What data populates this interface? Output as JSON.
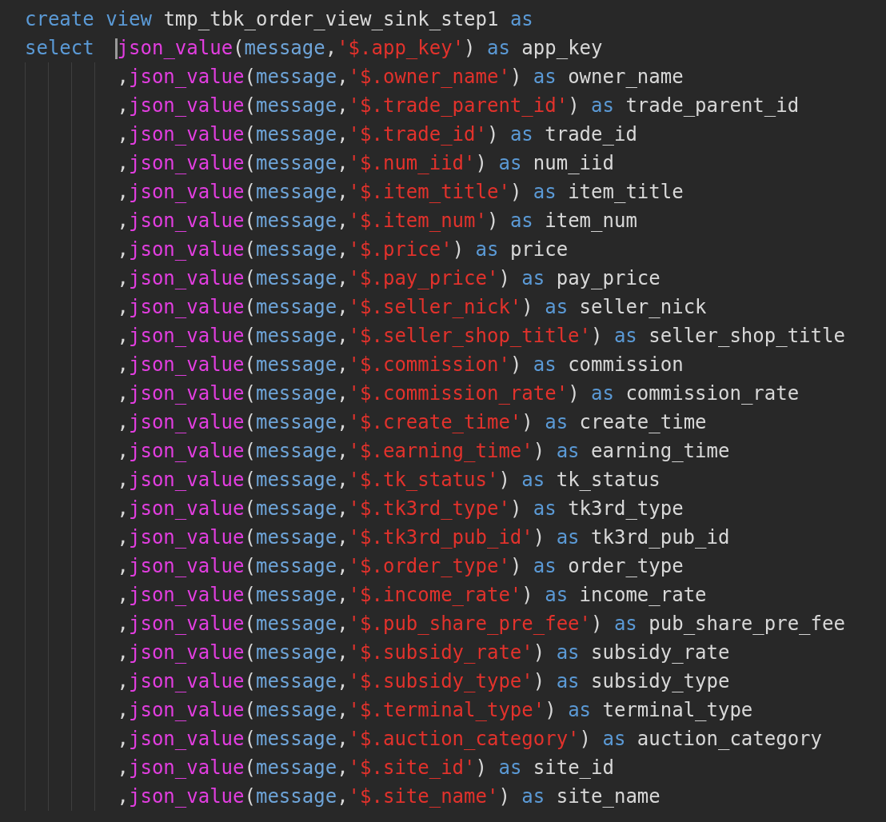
{
  "editor": {
    "lines": [
      {
        "indented": false,
        "tokens": [
          {
            "kind": "keyword",
            "text": "create "
          },
          {
            "kind": "keyword",
            "text": "view"
          },
          {
            "kind": "text",
            "text": " tmp_tbk_order_view_sink_step1 "
          },
          {
            "kind": "keyword",
            "text": "as"
          }
        ]
      },
      {
        "indented": false,
        "tokens": [
          {
            "kind": "keyword",
            "text": "select  "
          },
          {
            "kind": "function",
            "text": "json_value",
            "cursor": true
          },
          {
            "kind": "text",
            "text": "("
          },
          {
            "kind": "identifier",
            "text": "message"
          },
          {
            "kind": "text",
            "text": ","
          },
          {
            "kind": "string",
            "text": "'$.app_key'"
          },
          {
            "kind": "text",
            "text": ") "
          },
          {
            "kind": "keyword",
            "text": "as"
          },
          {
            "kind": "text",
            "text": " app_key"
          }
        ]
      },
      {
        "indented": true,
        "tokens": [
          {
            "kind": "text",
            "text": ","
          },
          {
            "kind": "function",
            "text": "json_value"
          },
          {
            "kind": "text",
            "text": "("
          },
          {
            "kind": "identifier",
            "text": "message"
          },
          {
            "kind": "text",
            "text": ","
          },
          {
            "kind": "string",
            "text": "'$.owner_name'"
          },
          {
            "kind": "text",
            "text": ") "
          },
          {
            "kind": "keyword",
            "text": "as"
          },
          {
            "kind": "text",
            "text": " owner_name"
          }
        ]
      },
      {
        "indented": true,
        "tokens": [
          {
            "kind": "text",
            "text": ","
          },
          {
            "kind": "function",
            "text": "json_value"
          },
          {
            "kind": "text",
            "text": "("
          },
          {
            "kind": "identifier",
            "text": "message"
          },
          {
            "kind": "text",
            "text": ","
          },
          {
            "kind": "string",
            "text": "'$.trade_parent_id'"
          },
          {
            "kind": "text",
            "text": ") "
          },
          {
            "kind": "keyword",
            "text": "as"
          },
          {
            "kind": "text",
            "text": " trade_parent_id"
          }
        ]
      },
      {
        "indented": true,
        "tokens": [
          {
            "kind": "text",
            "text": ","
          },
          {
            "kind": "function",
            "text": "json_value"
          },
          {
            "kind": "text",
            "text": "("
          },
          {
            "kind": "identifier",
            "text": "message"
          },
          {
            "kind": "text",
            "text": ","
          },
          {
            "kind": "string",
            "text": "'$.trade_id'"
          },
          {
            "kind": "text",
            "text": ") "
          },
          {
            "kind": "keyword",
            "text": "as"
          },
          {
            "kind": "text",
            "text": " trade_id"
          }
        ]
      },
      {
        "indented": true,
        "tokens": [
          {
            "kind": "text",
            "text": ","
          },
          {
            "kind": "function",
            "text": "json_value"
          },
          {
            "kind": "text",
            "text": "("
          },
          {
            "kind": "identifier",
            "text": "message"
          },
          {
            "kind": "text",
            "text": ","
          },
          {
            "kind": "string",
            "text": "'$.num_iid'"
          },
          {
            "kind": "text",
            "text": ") "
          },
          {
            "kind": "keyword",
            "text": "as"
          },
          {
            "kind": "text",
            "text": " num_iid"
          }
        ]
      },
      {
        "indented": true,
        "tokens": [
          {
            "kind": "text",
            "text": ","
          },
          {
            "kind": "function",
            "text": "json_value"
          },
          {
            "kind": "text",
            "text": "("
          },
          {
            "kind": "identifier",
            "text": "message"
          },
          {
            "kind": "text",
            "text": ","
          },
          {
            "kind": "string",
            "text": "'$.item_title'"
          },
          {
            "kind": "text",
            "text": ") "
          },
          {
            "kind": "keyword",
            "text": "as"
          },
          {
            "kind": "text",
            "text": " item_title"
          }
        ]
      },
      {
        "indented": true,
        "tokens": [
          {
            "kind": "text",
            "text": ","
          },
          {
            "kind": "function",
            "text": "json_value"
          },
          {
            "kind": "text",
            "text": "("
          },
          {
            "kind": "identifier",
            "text": "message"
          },
          {
            "kind": "text",
            "text": ","
          },
          {
            "kind": "string",
            "text": "'$.item_num'"
          },
          {
            "kind": "text",
            "text": ") "
          },
          {
            "kind": "keyword",
            "text": "as"
          },
          {
            "kind": "text",
            "text": " item_num"
          }
        ]
      },
      {
        "indented": true,
        "tokens": [
          {
            "kind": "text",
            "text": ","
          },
          {
            "kind": "function",
            "text": "json_value"
          },
          {
            "kind": "text",
            "text": "("
          },
          {
            "kind": "identifier",
            "text": "message"
          },
          {
            "kind": "text",
            "text": ","
          },
          {
            "kind": "string",
            "text": "'$.price'"
          },
          {
            "kind": "text",
            "text": ") "
          },
          {
            "kind": "keyword",
            "text": "as"
          },
          {
            "kind": "text",
            "text": " price"
          }
        ]
      },
      {
        "indented": true,
        "tokens": [
          {
            "kind": "text",
            "text": ","
          },
          {
            "kind": "function",
            "text": "json_value"
          },
          {
            "kind": "text",
            "text": "("
          },
          {
            "kind": "identifier",
            "text": "message"
          },
          {
            "kind": "text",
            "text": ","
          },
          {
            "kind": "string",
            "text": "'$.pay_price'"
          },
          {
            "kind": "text",
            "text": ") "
          },
          {
            "kind": "keyword",
            "text": "as"
          },
          {
            "kind": "text",
            "text": " pay_price"
          }
        ]
      },
      {
        "indented": true,
        "tokens": [
          {
            "kind": "text",
            "text": ","
          },
          {
            "kind": "function",
            "text": "json_value"
          },
          {
            "kind": "text",
            "text": "("
          },
          {
            "kind": "identifier",
            "text": "message"
          },
          {
            "kind": "text",
            "text": ","
          },
          {
            "kind": "string",
            "text": "'$.seller_nick'"
          },
          {
            "kind": "text",
            "text": ") "
          },
          {
            "kind": "keyword",
            "text": "as"
          },
          {
            "kind": "text",
            "text": " seller_nick"
          }
        ]
      },
      {
        "indented": true,
        "tokens": [
          {
            "kind": "text",
            "text": ","
          },
          {
            "kind": "function",
            "text": "json_value"
          },
          {
            "kind": "text",
            "text": "("
          },
          {
            "kind": "identifier",
            "text": "message"
          },
          {
            "kind": "text",
            "text": ","
          },
          {
            "kind": "string",
            "text": "'$.seller_shop_title'"
          },
          {
            "kind": "text",
            "text": ") "
          },
          {
            "kind": "keyword",
            "text": "as"
          },
          {
            "kind": "text",
            "text": " seller_shop_title"
          }
        ]
      },
      {
        "indented": true,
        "tokens": [
          {
            "kind": "text",
            "text": ","
          },
          {
            "kind": "function",
            "text": "json_value"
          },
          {
            "kind": "text",
            "text": "("
          },
          {
            "kind": "identifier",
            "text": "message"
          },
          {
            "kind": "text",
            "text": ","
          },
          {
            "kind": "string",
            "text": "'$.commission'"
          },
          {
            "kind": "text",
            "text": ") "
          },
          {
            "kind": "keyword",
            "text": "as"
          },
          {
            "kind": "text",
            "text": " commission"
          }
        ]
      },
      {
        "indented": true,
        "tokens": [
          {
            "kind": "text",
            "text": ","
          },
          {
            "kind": "function",
            "text": "json_value"
          },
          {
            "kind": "text",
            "text": "("
          },
          {
            "kind": "identifier",
            "text": "message"
          },
          {
            "kind": "text",
            "text": ","
          },
          {
            "kind": "string",
            "text": "'$.commission_rate'"
          },
          {
            "kind": "text",
            "text": ") "
          },
          {
            "kind": "keyword",
            "text": "as"
          },
          {
            "kind": "text",
            "text": " commission_rate"
          }
        ]
      },
      {
        "indented": true,
        "tokens": [
          {
            "kind": "text",
            "text": ","
          },
          {
            "kind": "function",
            "text": "json_value"
          },
          {
            "kind": "text",
            "text": "("
          },
          {
            "kind": "identifier",
            "text": "message"
          },
          {
            "kind": "text",
            "text": ","
          },
          {
            "kind": "string",
            "text": "'$.create_time'"
          },
          {
            "kind": "text",
            "text": ") "
          },
          {
            "kind": "keyword",
            "text": "as"
          },
          {
            "kind": "text",
            "text": " create_time"
          }
        ]
      },
      {
        "indented": true,
        "tokens": [
          {
            "kind": "text",
            "text": ","
          },
          {
            "kind": "function",
            "text": "json_value"
          },
          {
            "kind": "text",
            "text": "("
          },
          {
            "kind": "identifier",
            "text": "message"
          },
          {
            "kind": "text",
            "text": ","
          },
          {
            "kind": "string",
            "text": "'$.earning_time'"
          },
          {
            "kind": "text",
            "text": ") "
          },
          {
            "kind": "keyword",
            "text": "as"
          },
          {
            "kind": "text",
            "text": " earning_time"
          }
        ]
      },
      {
        "indented": true,
        "tokens": [
          {
            "kind": "text",
            "text": ","
          },
          {
            "kind": "function",
            "text": "json_value"
          },
          {
            "kind": "text",
            "text": "("
          },
          {
            "kind": "identifier",
            "text": "message"
          },
          {
            "kind": "text",
            "text": ","
          },
          {
            "kind": "string",
            "text": "'$.tk_status'"
          },
          {
            "kind": "text",
            "text": ") "
          },
          {
            "kind": "keyword",
            "text": "as"
          },
          {
            "kind": "text",
            "text": " tk_status"
          }
        ]
      },
      {
        "indented": true,
        "tokens": [
          {
            "kind": "text",
            "text": ","
          },
          {
            "kind": "function",
            "text": "json_value"
          },
          {
            "kind": "text",
            "text": "("
          },
          {
            "kind": "identifier",
            "text": "message"
          },
          {
            "kind": "text",
            "text": ","
          },
          {
            "kind": "string",
            "text": "'$.tk3rd_type'"
          },
          {
            "kind": "text",
            "text": ") "
          },
          {
            "kind": "keyword",
            "text": "as"
          },
          {
            "kind": "text",
            "text": " tk3rd_type"
          }
        ]
      },
      {
        "indented": true,
        "tokens": [
          {
            "kind": "text",
            "text": ","
          },
          {
            "kind": "function",
            "text": "json_value"
          },
          {
            "kind": "text",
            "text": "("
          },
          {
            "kind": "identifier",
            "text": "message"
          },
          {
            "kind": "text",
            "text": ","
          },
          {
            "kind": "string",
            "text": "'$.tk3rd_pub_id'"
          },
          {
            "kind": "text",
            "text": ") "
          },
          {
            "kind": "keyword",
            "text": "as"
          },
          {
            "kind": "text",
            "text": " tk3rd_pub_id"
          }
        ]
      },
      {
        "indented": true,
        "tokens": [
          {
            "kind": "text",
            "text": ","
          },
          {
            "kind": "function",
            "text": "json_value"
          },
          {
            "kind": "text",
            "text": "("
          },
          {
            "kind": "identifier",
            "text": "message"
          },
          {
            "kind": "text",
            "text": ","
          },
          {
            "kind": "string",
            "text": "'$.order_type'"
          },
          {
            "kind": "text",
            "text": ") "
          },
          {
            "kind": "keyword",
            "text": "as"
          },
          {
            "kind": "text",
            "text": " order_type"
          }
        ]
      },
      {
        "indented": true,
        "tokens": [
          {
            "kind": "text",
            "text": ","
          },
          {
            "kind": "function",
            "text": "json_value"
          },
          {
            "kind": "text",
            "text": "("
          },
          {
            "kind": "identifier",
            "text": "message"
          },
          {
            "kind": "text",
            "text": ","
          },
          {
            "kind": "string",
            "text": "'$.income_rate'"
          },
          {
            "kind": "text",
            "text": ") "
          },
          {
            "kind": "keyword",
            "text": "as"
          },
          {
            "kind": "text",
            "text": " income_rate"
          }
        ]
      },
      {
        "indented": true,
        "tokens": [
          {
            "kind": "text",
            "text": ","
          },
          {
            "kind": "function",
            "text": "json_value"
          },
          {
            "kind": "text",
            "text": "("
          },
          {
            "kind": "identifier",
            "text": "message"
          },
          {
            "kind": "text",
            "text": ","
          },
          {
            "kind": "string",
            "text": "'$.pub_share_pre_fee'"
          },
          {
            "kind": "text",
            "text": ") "
          },
          {
            "kind": "keyword",
            "text": "as"
          },
          {
            "kind": "text",
            "text": " pub_share_pre_fee"
          }
        ]
      },
      {
        "indented": true,
        "tokens": [
          {
            "kind": "text",
            "text": ","
          },
          {
            "kind": "function",
            "text": "json_value"
          },
          {
            "kind": "text",
            "text": "("
          },
          {
            "kind": "identifier",
            "text": "message"
          },
          {
            "kind": "text",
            "text": ","
          },
          {
            "kind": "string",
            "text": "'$.subsidy_rate'"
          },
          {
            "kind": "text",
            "text": ") "
          },
          {
            "kind": "keyword",
            "text": "as"
          },
          {
            "kind": "text",
            "text": " subsidy_rate"
          }
        ]
      },
      {
        "indented": true,
        "tokens": [
          {
            "kind": "text",
            "text": ","
          },
          {
            "kind": "function",
            "text": "json_value"
          },
          {
            "kind": "text",
            "text": "("
          },
          {
            "kind": "identifier",
            "text": "message"
          },
          {
            "kind": "text",
            "text": ","
          },
          {
            "kind": "string",
            "text": "'$.subsidy_type'"
          },
          {
            "kind": "text",
            "text": ") "
          },
          {
            "kind": "keyword",
            "text": "as"
          },
          {
            "kind": "text",
            "text": " subsidy_type"
          }
        ]
      },
      {
        "indented": true,
        "tokens": [
          {
            "kind": "text",
            "text": ","
          },
          {
            "kind": "function",
            "text": "json_value"
          },
          {
            "kind": "text",
            "text": "("
          },
          {
            "kind": "identifier",
            "text": "message"
          },
          {
            "kind": "text",
            "text": ","
          },
          {
            "kind": "string",
            "text": "'$.terminal_type'"
          },
          {
            "kind": "text",
            "text": ") "
          },
          {
            "kind": "keyword",
            "text": "as"
          },
          {
            "kind": "text",
            "text": " terminal_type"
          }
        ]
      },
      {
        "indented": true,
        "tokens": [
          {
            "kind": "text",
            "text": ","
          },
          {
            "kind": "function",
            "text": "json_value"
          },
          {
            "kind": "text",
            "text": "("
          },
          {
            "kind": "identifier",
            "text": "message"
          },
          {
            "kind": "text",
            "text": ","
          },
          {
            "kind": "string",
            "text": "'$.auction_category'"
          },
          {
            "kind": "text",
            "text": ") "
          },
          {
            "kind": "keyword",
            "text": "as"
          },
          {
            "kind": "text",
            "text": " auction_category"
          }
        ]
      },
      {
        "indented": true,
        "tokens": [
          {
            "kind": "text",
            "text": ","
          },
          {
            "kind": "function",
            "text": "json_value"
          },
          {
            "kind": "text",
            "text": "("
          },
          {
            "kind": "identifier",
            "text": "message"
          },
          {
            "kind": "text",
            "text": ","
          },
          {
            "kind": "string",
            "text": "'$.site_id'"
          },
          {
            "kind": "text",
            "text": ") "
          },
          {
            "kind": "keyword",
            "text": "as"
          },
          {
            "kind": "text",
            "text": " site_id"
          }
        ]
      },
      {
        "indented": true,
        "tokens": [
          {
            "kind": "text",
            "text": ","
          },
          {
            "kind": "function",
            "text": "json_value"
          },
          {
            "kind": "text",
            "text": "("
          },
          {
            "kind": "identifier",
            "text": "message"
          },
          {
            "kind": "text",
            "text": ","
          },
          {
            "kind": "string",
            "text": "'$.site_name'"
          },
          {
            "kind": "text",
            "text": ") "
          },
          {
            "kind": "keyword",
            "text": "as"
          },
          {
            "kind": "text",
            "text": " site_name"
          }
        ]
      }
    ]
  }
}
